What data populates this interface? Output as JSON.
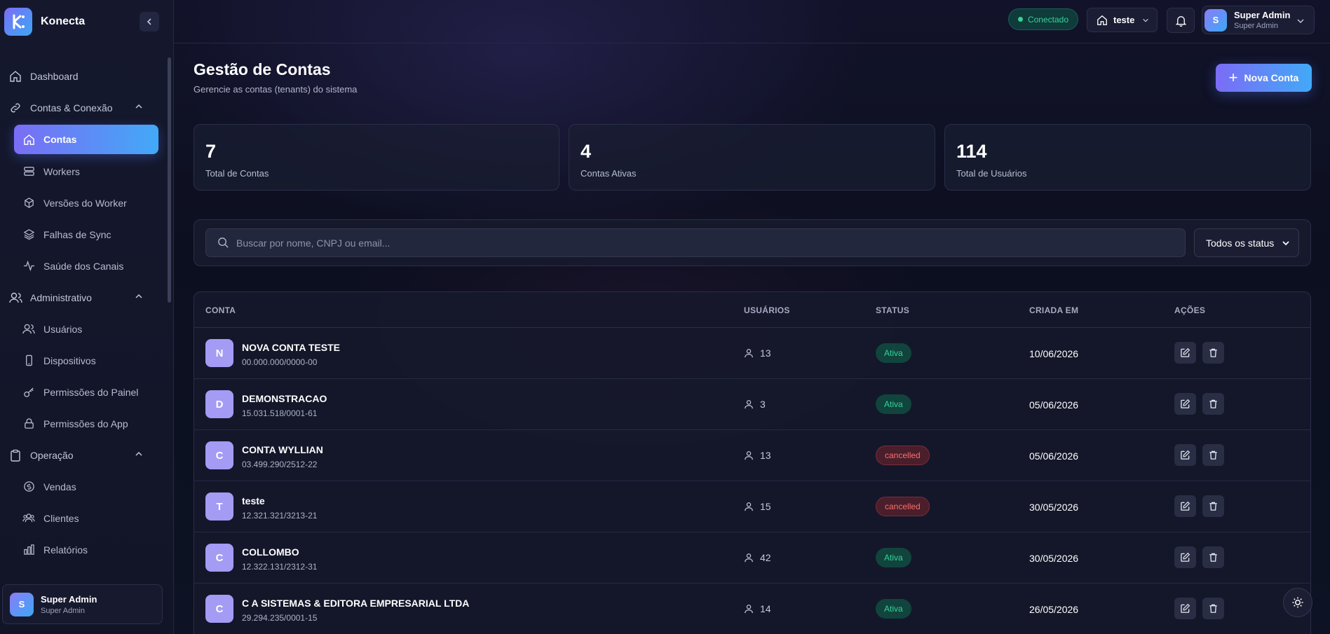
{
  "app": {
    "name": "Konecta"
  },
  "sidebar": {
    "dashboard": "Dashboard",
    "group_contas": "Contas & Conexão",
    "contas": "Contas",
    "workers": "Workers",
    "versoes": "Versões do Worker",
    "falhas": "Falhas de Sync",
    "saude": "Saúde dos Canais",
    "group_admin": "Administrativo",
    "usuarios": "Usuários",
    "dispositivos": "Dispositivos",
    "perm_painel": "Permissões do Painel",
    "perm_app": "Permissões do App",
    "group_operacao": "Operação",
    "vendas": "Vendas",
    "clientes": "Clientes",
    "relatorios": "Relatórios"
  },
  "user": {
    "initial": "S",
    "name": "Super Admin",
    "role": "Super Admin"
  },
  "topbar": {
    "status": "Conectado",
    "tenant": "teste"
  },
  "page": {
    "title": "Gestão de Contas",
    "subtitle": "Gerencie as contas (tenants) do sistema",
    "new_button": "Nova Conta"
  },
  "stats": [
    {
      "value": "7",
      "label": "Total de Contas"
    },
    {
      "value": "4",
      "label": "Contas Ativas"
    },
    {
      "value": "114",
      "label": "Total de Usuários"
    }
  ],
  "filters": {
    "search_placeholder": "Buscar por nome, CNPJ ou email...",
    "status_selected": "Todos os status"
  },
  "table": {
    "headers": {
      "conta": "CONTA",
      "usuarios": "USUÁRIOS",
      "status": "STATUS",
      "criada": "CRIADA EM",
      "acoes": "AÇÕES"
    },
    "rows": [
      {
        "initial": "N",
        "name": "NOVA CONTA TESTE",
        "doc": "00.000.000/0000-00",
        "users": "13",
        "status": "Ativa",
        "date": "10/06/2026"
      },
      {
        "initial": "D",
        "name": "DEMONSTRACAO",
        "doc": "15.031.518/0001-61",
        "users": "3",
        "status": "Ativa",
        "date": "05/06/2026"
      },
      {
        "initial": "C",
        "name": "CONTA WYLLIAN",
        "doc": "03.499.290/2512-22",
        "users": "13",
        "status": "cancelled",
        "date": "05/06/2026"
      },
      {
        "initial": "T",
        "name": "teste",
        "doc": "12.321.321/3213-21",
        "users": "15",
        "status": "cancelled",
        "date": "30/05/2026"
      },
      {
        "initial": "C",
        "name": "COLLOMBO",
        "doc": "12.322.131/2312-31",
        "users": "42",
        "status": "Ativa",
        "date": "30/05/2026"
      },
      {
        "initial": "C",
        "name": "C A SISTEMAS & EDITORA EMPRESARIAL LTDA",
        "doc": "29.294.235/0001-15",
        "users": "14",
        "status": "Ativa",
        "date": "26/05/2026"
      }
    ]
  },
  "colors": {
    "accent_start": "#7b6cf6",
    "accent_end": "#42a9f7",
    "active_green": "#34d399",
    "cancel_red": "#f87171"
  }
}
